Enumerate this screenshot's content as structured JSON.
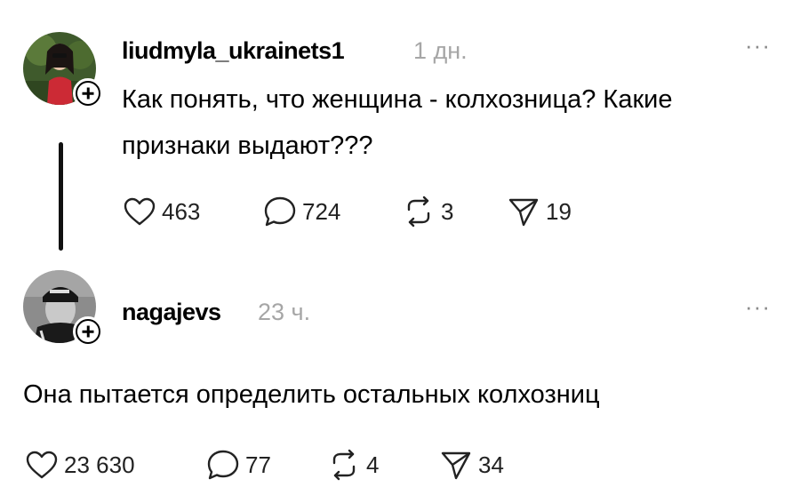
{
  "post": {
    "username": "liudmyla_ukrainets1",
    "time": "1 дн.",
    "more": "···",
    "text_line1": "Как понять, что женщина - колхозница? Какие",
    "text_line2": "признаки выдают???",
    "likes": "463",
    "comments": "724",
    "reposts": "3",
    "shares": "19"
  },
  "reply": {
    "username": "nagajevs",
    "time": "23 ч.",
    "more": "···",
    "text": "Она пытается определить остальных колхозниц",
    "likes": "23 630",
    "comments": "77",
    "reposts": "4",
    "shares": "34"
  }
}
